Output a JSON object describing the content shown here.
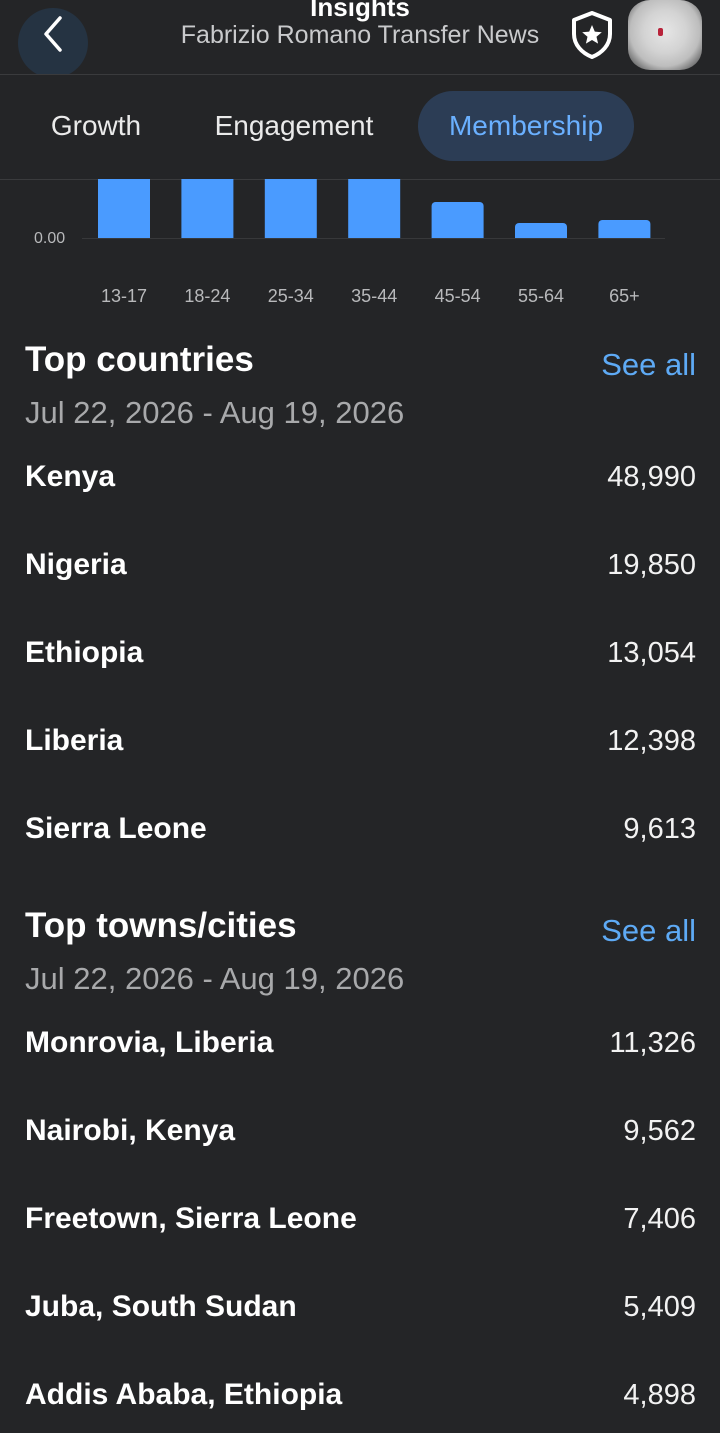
{
  "header": {
    "title": "Insights",
    "subtitle": "Fabrizio Romano Transfer News"
  },
  "tabs": [
    {
      "label": "Growth",
      "active": false
    },
    {
      "label": "Engagement",
      "active": false
    },
    {
      "label": "Membership",
      "active": true
    }
  ],
  "chart_data": {
    "type": "bar",
    "categories": [
      "13-17",
      "18-24",
      "25-34",
      "35-44",
      "45-54",
      "55-64",
      "65+"
    ],
    "values": [
      null,
      null,
      null,
      null,
      0.6,
      0.25,
      0.3
    ],
    "clipped_top": [
      true,
      true,
      true,
      true,
      false,
      false,
      false
    ],
    "y_tick_labels": [
      "0.00"
    ],
    "color": "#4a9bff"
  },
  "top_countries": {
    "title": "Top countries",
    "see_all": "See all",
    "date_range": "Jul 22, 2026 - Aug 19, 2026",
    "rows": [
      {
        "name": "Kenya",
        "value": "48,990"
      },
      {
        "name": "Nigeria",
        "value": "19,850"
      },
      {
        "name": "Ethiopia",
        "value": "13,054"
      },
      {
        "name": "Liberia",
        "value": "12,398"
      },
      {
        "name": "Sierra Leone",
        "value": "9,613"
      }
    ]
  },
  "top_cities": {
    "title": "Top towns/cities",
    "see_all": "See all",
    "date_range": "Jul 22, 2026 - Aug 19, 2026",
    "rows": [
      {
        "name": "Monrovia, Liberia",
        "value": "11,326"
      },
      {
        "name": "Nairobi, Kenya",
        "value": "9,562"
      },
      {
        "name": "Freetown, Sierra Leone",
        "value": "7,406"
      },
      {
        "name": "Juba, South Sudan",
        "value": "5,409"
      },
      {
        "name": "Addis Ababa, Ethiopia",
        "value": "4,898"
      }
    ]
  },
  "colors": {
    "background": "#242527",
    "accent": "#5eaaf5",
    "active_tab_bg": "#2c3d55"
  }
}
